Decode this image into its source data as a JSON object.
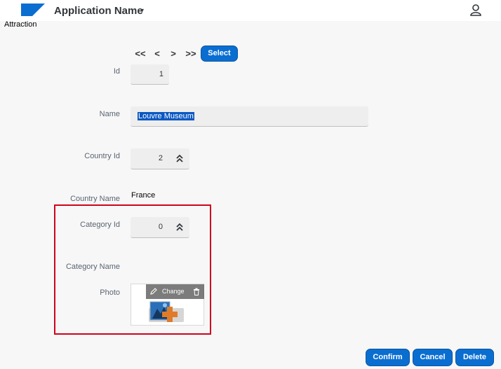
{
  "shell": {
    "app_name": "Application Name",
    "app_caret": "▾",
    "logo_color": "#0a6ed1",
    "user_icon": "person-icon"
  },
  "page": {
    "title": "Attraction"
  },
  "pager": {
    "first": "<<",
    "prev": "<",
    "next": ">",
    "last": ">>",
    "select_label": "Select"
  },
  "form": {
    "id_label": "Id",
    "id_value": "1",
    "name_label": "Name",
    "name_value": "Louvre Museum",
    "country_id_label": "Country Id",
    "country_id_value": "2",
    "country_name_label": "Country Name",
    "country_name_value": "France",
    "category_id_label": "Category Id",
    "category_id_value": "0",
    "category_name_label": "Category Name",
    "category_name_value": "",
    "photo_label": "Photo",
    "photo_change_label": "Change"
  },
  "actions": {
    "confirm": "Confirm",
    "cancel": "Cancel",
    "delete": "Delete"
  },
  "colors": {
    "accent": "#0a6ed1",
    "highlight": "#d0021b"
  }
}
